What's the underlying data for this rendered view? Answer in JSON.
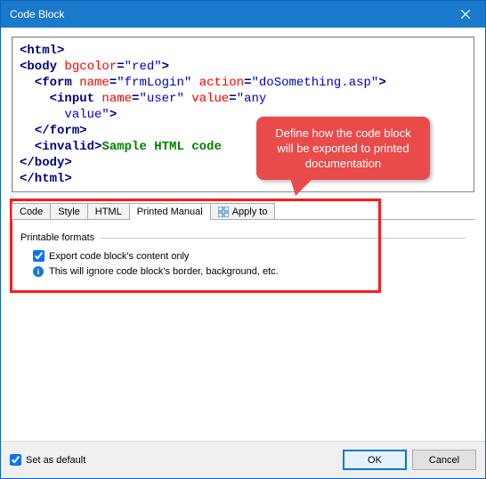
{
  "window": {
    "title": "Code Block"
  },
  "code": {
    "l1_open": "<html>",
    "l2_open": "<body",
    "l2_attr": " bgcolor",
    "l2_eq": "=",
    "l2_val": "\"red\"",
    "l2_close": ">",
    "l3_open": "<form",
    "l3_attr1": " name",
    "l3_val1": "\"frmLogin\"",
    "l3_attr2": " action",
    "l3_val2": "\"doSomething.asp\"",
    "l3_close": ">",
    "l4_open": "<input",
    "l4_attr1": " name",
    "l4_val1": "\"user\"",
    "l4_attr2": " value",
    "l4_val2": "\"any",
    "l5_valcont": "value\"",
    "l5_close": ">",
    "l6": "</form>",
    "l7_open": "<invalid>",
    "l7_text": "Sample HTML code",
    "l8": "</body>",
    "l9": "</html>"
  },
  "tabs": {
    "code": "Code",
    "style": "Style",
    "html": "HTML",
    "printed": "Printed Manual",
    "apply": "Apply to"
  },
  "group": {
    "title": "Printable formats",
    "checkbox_label": "Export code block's content only",
    "info_text": "This will ignore code block's border, background, etc."
  },
  "callout": {
    "text": "Define how the code block will be exported to printed documentation"
  },
  "footer": {
    "default_label": "Set as default",
    "ok": "OK",
    "cancel": "Cancel"
  }
}
